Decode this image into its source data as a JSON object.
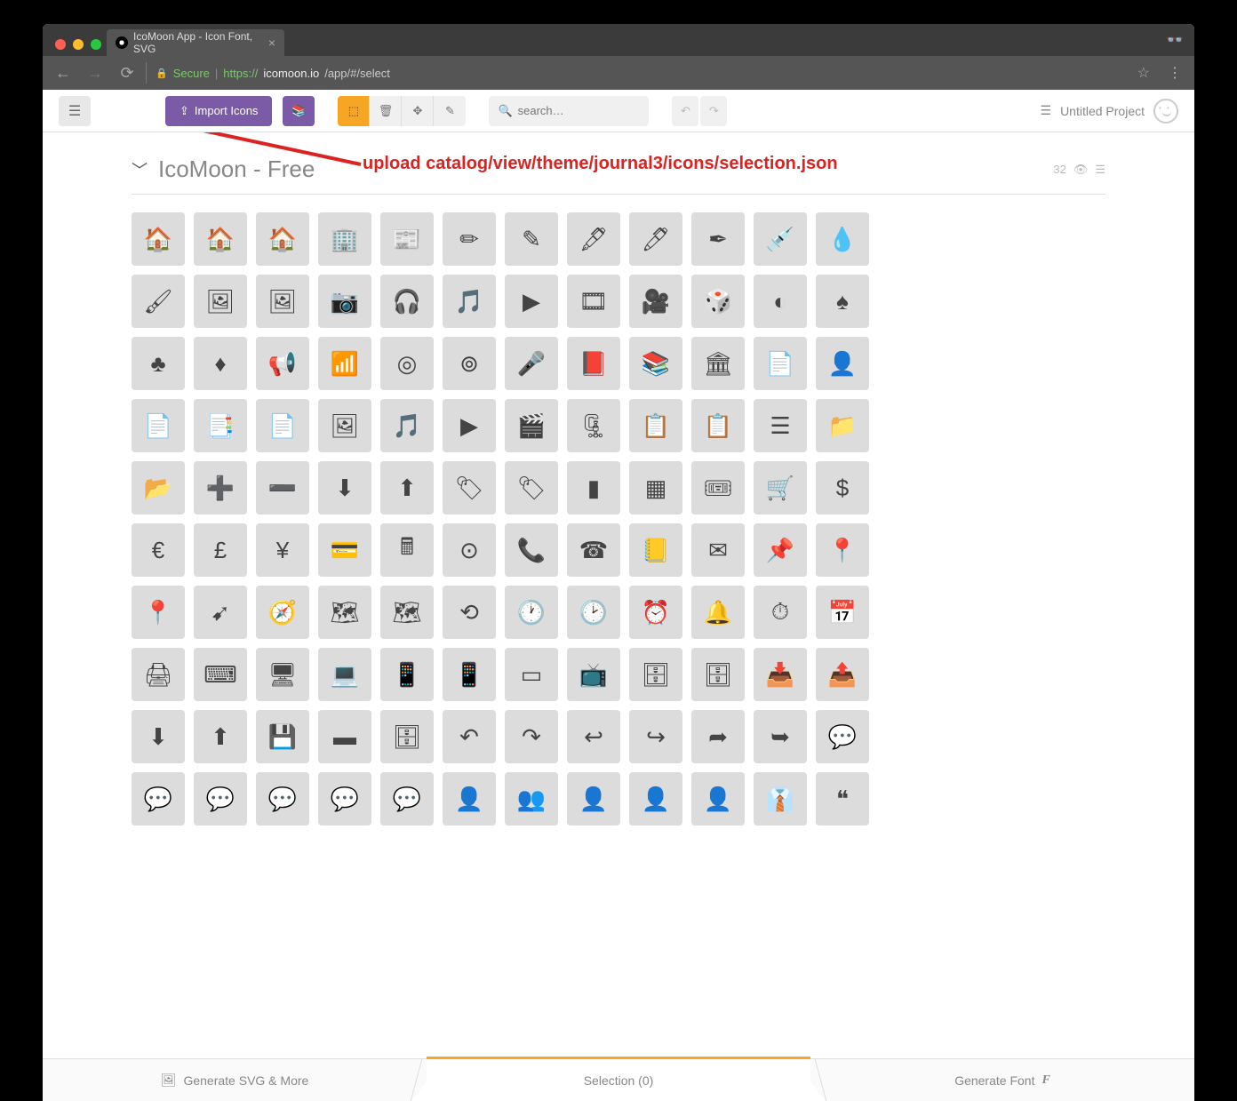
{
  "browser": {
    "tab_title": "IcoMoon App - Icon Font, SVG",
    "secure_label": "Secure",
    "url_prefix": "https://",
    "url_host": "icomoon.io",
    "url_path": "/app/#/select"
  },
  "toolbar": {
    "import_label": "Import Icons",
    "search_placeholder": "search…",
    "project_label": "Untitled Project"
  },
  "set": {
    "title": "IcoMoon - Free",
    "count": "32"
  },
  "annotation": {
    "text": "upload catalog/view/theme/journal3/icons/selection.json"
  },
  "footer": {
    "svg_label": "Generate SVG & More",
    "selection_label": "Selection (0)",
    "font_label": "Generate Font"
  },
  "icons": [
    "home",
    "home2",
    "home3",
    "office",
    "newspaper",
    "pencil",
    "pencil2",
    "quill",
    "pen",
    "blog",
    "eyedropper",
    "droplet",
    "paint-format",
    "image",
    "images",
    "camera",
    "headphones",
    "music",
    "play",
    "film",
    "video-camera",
    "dice",
    "pacman",
    "spades",
    "clubs",
    "diamonds",
    "bullhorn",
    "connection",
    "podcast",
    "feed",
    "mic",
    "book",
    "books",
    "library",
    "file-text",
    "profile",
    "file-empty",
    "files-empty",
    "file-text2",
    "file-picture",
    "file-music",
    "file-play",
    "file-video",
    "file-zip",
    "copy",
    "paste",
    "stack",
    "folder",
    "folder-open",
    "folder-plus",
    "folder-minus",
    "folder-download",
    "folder-upload",
    "price-tag",
    "price-tags",
    "barcode",
    "qrcode",
    "ticket",
    "cart",
    "coin-dollar",
    "coin-euro",
    "coin-pound",
    "coin-yen",
    "credit-card",
    "calculator",
    "lifebuoy",
    "phone",
    "phone-hang-up",
    "address-book",
    "envelop",
    "pushpin",
    "location",
    "location2",
    "compass",
    "compass2",
    "map",
    "map2",
    "history",
    "clock",
    "clock2",
    "alarm",
    "bell",
    "stopwatch",
    "calendar",
    "printer",
    "keyboard",
    "display",
    "laptop",
    "mobile",
    "mobile2",
    "tablet",
    "tv",
    "drawer",
    "drawer2",
    "box-add",
    "box-remove",
    "download",
    "upload",
    "floppy-disk",
    "drive",
    "database",
    "undo",
    "redo",
    "undo2",
    "redo2",
    "forward",
    "reply",
    "bubble",
    "bubbles",
    "bubbles2",
    "bubble2",
    "bubbles3",
    "bubbles4",
    "user",
    "users",
    "user-plus",
    "user-minus",
    "user-check",
    "user-tie",
    "quotes-left"
  ]
}
